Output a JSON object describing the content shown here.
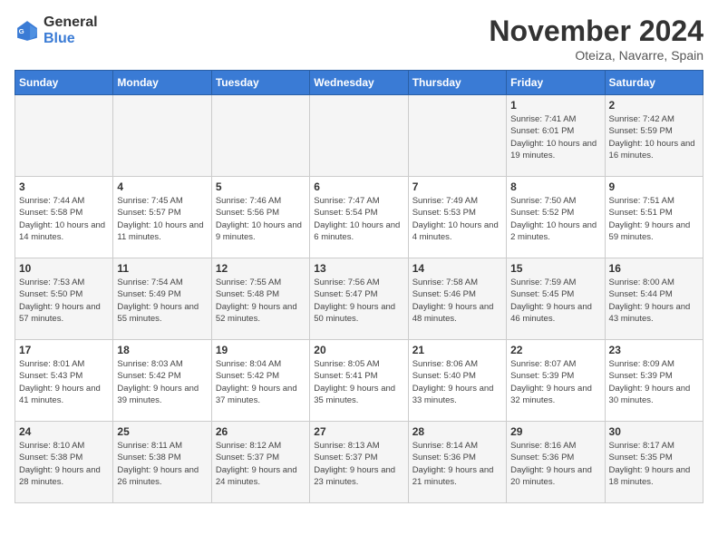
{
  "logo": {
    "line1": "General",
    "line2": "Blue"
  },
  "title": "November 2024",
  "location": "Oteiza, Navarre, Spain",
  "weekdays": [
    "Sunday",
    "Monday",
    "Tuesday",
    "Wednesday",
    "Thursday",
    "Friday",
    "Saturday"
  ],
  "weeks": [
    [
      {
        "day": "",
        "info": ""
      },
      {
        "day": "",
        "info": ""
      },
      {
        "day": "",
        "info": ""
      },
      {
        "day": "",
        "info": ""
      },
      {
        "day": "",
        "info": ""
      },
      {
        "day": "1",
        "info": "Sunrise: 7:41 AM\nSunset: 6:01 PM\nDaylight: 10 hours and 19 minutes."
      },
      {
        "day": "2",
        "info": "Sunrise: 7:42 AM\nSunset: 5:59 PM\nDaylight: 10 hours and 16 minutes."
      }
    ],
    [
      {
        "day": "3",
        "info": "Sunrise: 7:44 AM\nSunset: 5:58 PM\nDaylight: 10 hours and 14 minutes."
      },
      {
        "day": "4",
        "info": "Sunrise: 7:45 AM\nSunset: 5:57 PM\nDaylight: 10 hours and 11 minutes."
      },
      {
        "day": "5",
        "info": "Sunrise: 7:46 AM\nSunset: 5:56 PM\nDaylight: 10 hours and 9 minutes."
      },
      {
        "day": "6",
        "info": "Sunrise: 7:47 AM\nSunset: 5:54 PM\nDaylight: 10 hours and 6 minutes."
      },
      {
        "day": "7",
        "info": "Sunrise: 7:49 AM\nSunset: 5:53 PM\nDaylight: 10 hours and 4 minutes."
      },
      {
        "day": "8",
        "info": "Sunrise: 7:50 AM\nSunset: 5:52 PM\nDaylight: 10 hours and 2 minutes."
      },
      {
        "day": "9",
        "info": "Sunrise: 7:51 AM\nSunset: 5:51 PM\nDaylight: 9 hours and 59 minutes."
      }
    ],
    [
      {
        "day": "10",
        "info": "Sunrise: 7:53 AM\nSunset: 5:50 PM\nDaylight: 9 hours and 57 minutes."
      },
      {
        "day": "11",
        "info": "Sunrise: 7:54 AM\nSunset: 5:49 PM\nDaylight: 9 hours and 55 minutes."
      },
      {
        "day": "12",
        "info": "Sunrise: 7:55 AM\nSunset: 5:48 PM\nDaylight: 9 hours and 52 minutes."
      },
      {
        "day": "13",
        "info": "Sunrise: 7:56 AM\nSunset: 5:47 PM\nDaylight: 9 hours and 50 minutes."
      },
      {
        "day": "14",
        "info": "Sunrise: 7:58 AM\nSunset: 5:46 PM\nDaylight: 9 hours and 48 minutes."
      },
      {
        "day": "15",
        "info": "Sunrise: 7:59 AM\nSunset: 5:45 PM\nDaylight: 9 hours and 46 minutes."
      },
      {
        "day": "16",
        "info": "Sunrise: 8:00 AM\nSunset: 5:44 PM\nDaylight: 9 hours and 43 minutes."
      }
    ],
    [
      {
        "day": "17",
        "info": "Sunrise: 8:01 AM\nSunset: 5:43 PM\nDaylight: 9 hours and 41 minutes."
      },
      {
        "day": "18",
        "info": "Sunrise: 8:03 AM\nSunset: 5:42 PM\nDaylight: 9 hours and 39 minutes."
      },
      {
        "day": "19",
        "info": "Sunrise: 8:04 AM\nSunset: 5:42 PM\nDaylight: 9 hours and 37 minutes."
      },
      {
        "day": "20",
        "info": "Sunrise: 8:05 AM\nSunset: 5:41 PM\nDaylight: 9 hours and 35 minutes."
      },
      {
        "day": "21",
        "info": "Sunrise: 8:06 AM\nSunset: 5:40 PM\nDaylight: 9 hours and 33 minutes."
      },
      {
        "day": "22",
        "info": "Sunrise: 8:07 AM\nSunset: 5:39 PM\nDaylight: 9 hours and 32 minutes."
      },
      {
        "day": "23",
        "info": "Sunrise: 8:09 AM\nSunset: 5:39 PM\nDaylight: 9 hours and 30 minutes."
      }
    ],
    [
      {
        "day": "24",
        "info": "Sunrise: 8:10 AM\nSunset: 5:38 PM\nDaylight: 9 hours and 28 minutes."
      },
      {
        "day": "25",
        "info": "Sunrise: 8:11 AM\nSunset: 5:38 PM\nDaylight: 9 hours and 26 minutes."
      },
      {
        "day": "26",
        "info": "Sunrise: 8:12 AM\nSunset: 5:37 PM\nDaylight: 9 hours and 24 minutes."
      },
      {
        "day": "27",
        "info": "Sunrise: 8:13 AM\nSunset: 5:37 PM\nDaylight: 9 hours and 23 minutes."
      },
      {
        "day": "28",
        "info": "Sunrise: 8:14 AM\nSunset: 5:36 PM\nDaylight: 9 hours and 21 minutes."
      },
      {
        "day": "29",
        "info": "Sunrise: 8:16 AM\nSunset: 5:36 PM\nDaylight: 9 hours and 20 minutes."
      },
      {
        "day": "30",
        "info": "Sunrise: 8:17 AM\nSunset: 5:35 PM\nDaylight: 9 hours and 18 minutes."
      }
    ]
  ]
}
